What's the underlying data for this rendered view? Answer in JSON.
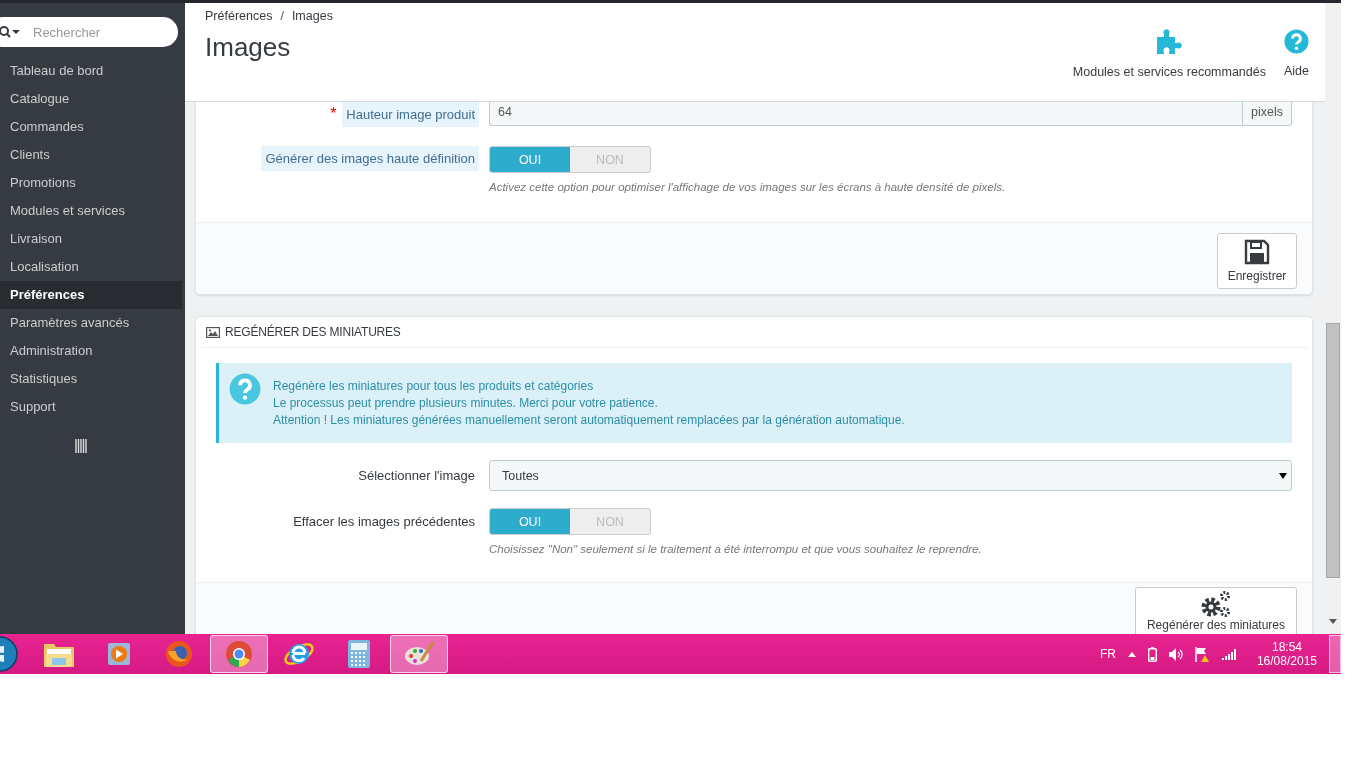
{
  "sidebar": {
    "search": {
      "placeholder": "Rechercher"
    },
    "items": [
      {
        "label": "Tableau de bord",
        "selected": false
      },
      {
        "label": "Catalogue",
        "selected": false
      },
      {
        "label": "Commandes",
        "selected": false
      },
      {
        "label": "Clients",
        "selected": false
      },
      {
        "label": "Promotions",
        "selected": false
      },
      {
        "label": "Modules et services",
        "selected": false
      },
      {
        "label": "Livraison",
        "selected": false
      },
      {
        "label": "Localisation",
        "selected": false
      },
      {
        "label": "Préférences",
        "selected": true
      },
      {
        "label": "Paramètres avancés",
        "selected": false
      },
      {
        "label": "Administration",
        "selected": false
      },
      {
        "label": "Statistiques",
        "selected": false
      },
      {
        "label": "Support",
        "selected": false
      }
    ]
  },
  "header": {
    "breadcrumb": [
      "Préférences",
      "Images"
    ],
    "breadcrumb_separator": "/",
    "title": "Images",
    "actions": [
      {
        "kind": "puzzle",
        "label": "Modules et services recommandés"
      },
      {
        "kind": "help",
        "label": "Aide"
      }
    ]
  },
  "settings_panel": {
    "fields": [
      {
        "kind": "text",
        "label": "Hauteur image produit",
        "required_mark": "*",
        "tooltip": true,
        "value": "64",
        "suffix": "pixels"
      },
      {
        "kind": "switch",
        "label": "Générer des images haute définition",
        "tooltip": true,
        "options": [
          {
            "label": "OUI",
            "selected": true
          },
          {
            "label": "NON",
            "selected": false
          }
        ],
        "help": "Activez cette option pour optimiser l'affichage de vos images sur les écrans à haute densité de pixels."
      }
    ],
    "button": "Enregistrer"
  },
  "regenerate_panel": {
    "title": "REGÉNÉRER DES MINIATURES",
    "alert": [
      "Regénère les miniatures pour tous les produits et catégories",
      "Le processus peut prendre plusieurs minutes. Merci pour votre patience.",
      "Attention ! Les miniatures générées manuellement seront automatiquement remplacées par la génération automatique."
    ],
    "fields": [
      {
        "kind": "select",
        "label": "Sélectionner l'image",
        "tooltip": false,
        "value": "Toutes"
      },
      {
        "kind": "switch",
        "label": "Effacer les images précédentes",
        "tooltip": false,
        "options": [
          {
            "label": "OUI",
            "selected": true
          },
          {
            "label": "NON",
            "selected": false
          }
        ],
        "help": "Choisissez \"Non\" seulement si le traitement a été interrompu et que vous souhaitez le reprendre."
      }
    ],
    "button": "Regénérer des miniatures"
  },
  "taskbar": {
    "apps": [
      {
        "kind": "folder",
        "selected": false
      },
      {
        "kind": "media",
        "selected": false
      },
      {
        "kind": "firefox",
        "selected": false
      },
      {
        "kind": "chrome",
        "selected": true
      },
      {
        "kind": "ie",
        "selected": false
      },
      {
        "kind": "calculator",
        "selected": false
      },
      {
        "kind": "paint",
        "selected": true
      }
    ],
    "language": "FR",
    "time": "18:54",
    "date": "16/08/2015"
  }
}
